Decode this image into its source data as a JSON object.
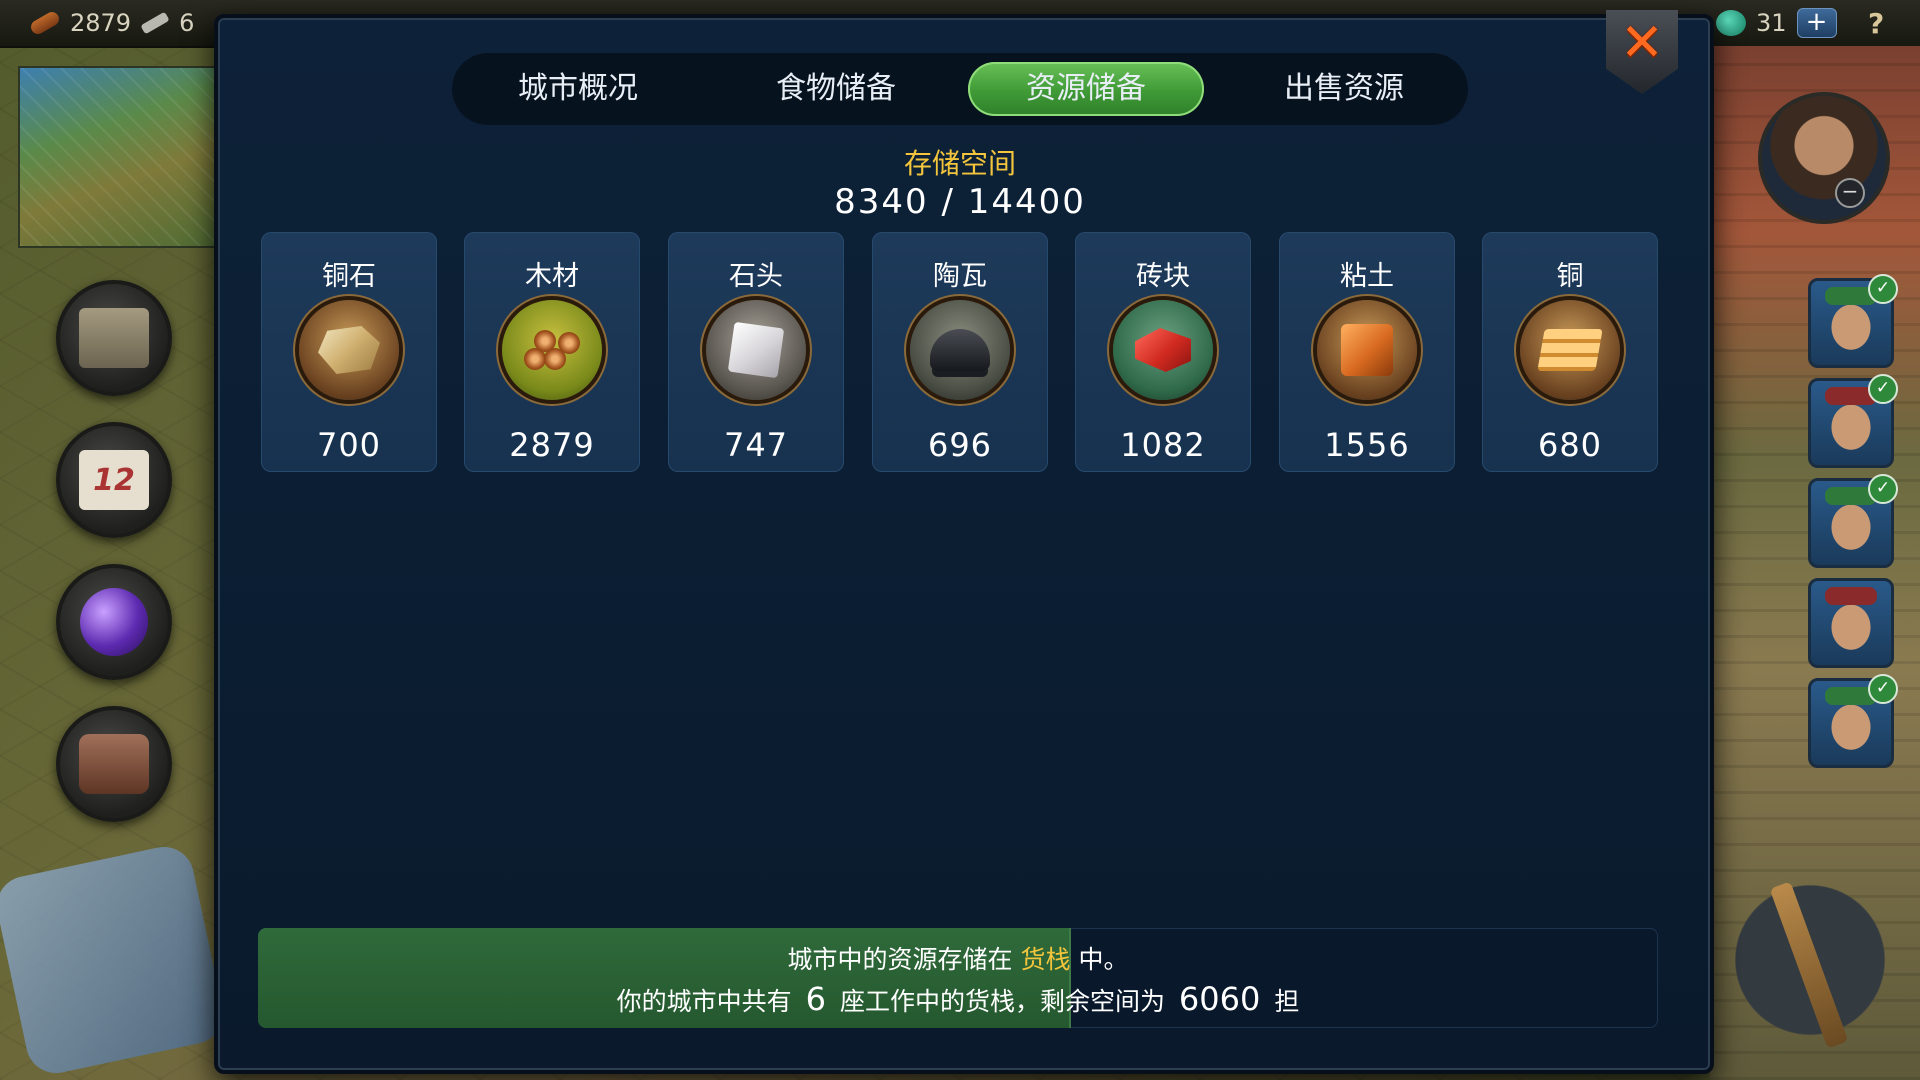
{
  "topbar": {
    "wood_count": "2879",
    "second_resource_partial": "6",
    "gems": "31",
    "plus_label": "+",
    "help_label": "?"
  },
  "left_buttons": {
    "calendar_day": "12"
  },
  "right_panel": {
    "zoom_label": "−",
    "check_mark": "✓"
  },
  "dialog": {
    "tabs": [
      {
        "label": "城市概况"
      },
      {
        "label": "食物储备"
      },
      {
        "label": "资源储备"
      },
      {
        "label": "出售资源"
      }
    ],
    "active_tab_index": 2,
    "close_label": "✕",
    "storage": {
      "title": "存储空间",
      "value": "8340 / 14400",
      "used": 8340,
      "capacity": 14400
    },
    "resources": [
      {
        "name": "铜石",
        "qty": "700",
        "icon": "copper-ore-icon"
      },
      {
        "name": "木材",
        "qty": "2879",
        "icon": "wood-logs-icon"
      },
      {
        "name": "石头",
        "qty": "747",
        "icon": "stone-block-icon"
      },
      {
        "name": "陶瓦",
        "qty": "696",
        "icon": "roof-tile-icon"
      },
      {
        "name": "砖块",
        "qty": "1082",
        "icon": "brick-icon"
      },
      {
        "name": "粘土",
        "qty": "1556",
        "icon": "clay-icon"
      },
      {
        "name": "铜",
        "qty": "680",
        "icon": "copper-ingot-icon"
      }
    ],
    "info": {
      "line1_prefix": "城市中的资源存储在",
      "line1_highlight": "货栈",
      "line1_suffix": "中。",
      "line2_prefix": "你的城市中共有",
      "line2_count": "6",
      "line2_mid": "座工作中的货栈，剩余空间为",
      "line2_space": "6060",
      "line2_unit": "担",
      "fill_fraction": 0.5792
    }
  },
  "colors": {
    "accent_gold": "#f2c53c",
    "tab_active_green": "#3f9a36",
    "close_orange": "#ff6a20"
  }
}
